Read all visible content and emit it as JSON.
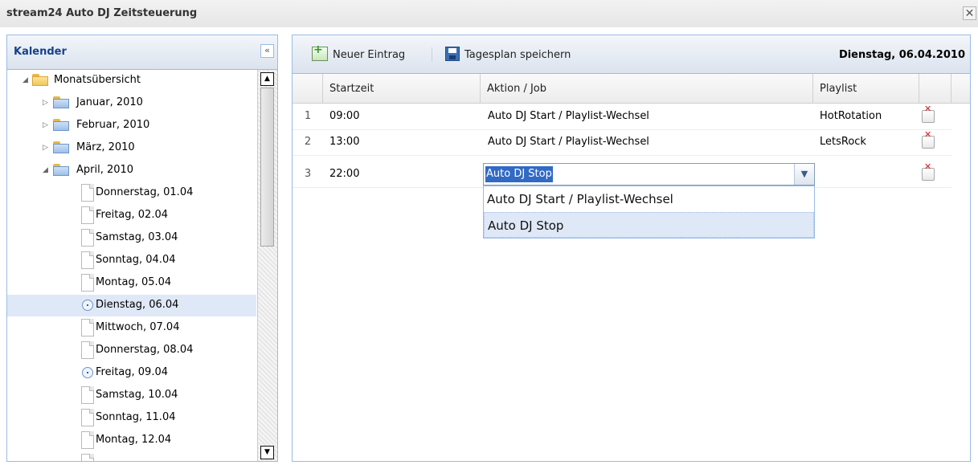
{
  "window": {
    "title": "stream24 Auto DJ Zeitsteuerung",
    "close_symbol": "✕"
  },
  "calendar": {
    "title": "Kalender",
    "collapse_symbol": "«",
    "tree": {
      "root": "Monatsübersicht",
      "months": [
        "Januar, 2010",
        "Februar, 2010",
        "März, 2010",
        "April, 2010"
      ],
      "days": [
        {
          "label": "Donnerstag, 01.04",
          "icon": "page-icon"
        },
        {
          "label": "Freitag, 02.04",
          "icon": "page-icon"
        },
        {
          "label": "Samstag, 03.04",
          "icon": "page-icon"
        },
        {
          "label": "Sonntag, 04.04",
          "icon": "page-icon"
        },
        {
          "label": "Montag, 05.04",
          "icon": "page-icon"
        },
        {
          "label": "Dienstag, 06.04",
          "icon": "clock-icon",
          "selected": true
        },
        {
          "label": "Mittwoch, 07.04",
          "icon": "page-icon"
        },
        {
          "label": "Donnerstag, 08.04",
          "icon": "page-icon"
        },
        {
          "label": "Freitag, 09.04",
          "icon": "clock-icon"
        },
        {
          "label": "Samstag, 10.04",
          "icon": "page-icon"
        },
        {
          "label": "Sonntag, 11.04",
          "icon": "page-icon"
        },
        {
          "label": "Montag, 12.04",
          "icon": "page-icon"
        }
      ]
    }
  },
  "toolbar": {
    "new_entry": "Neuer Eintrag",
    "save_plan": "Tagesplan speichern",
    "date": "Dienstag, 06.04.2010"
  },
  "grid": {
    "columns": [
      "Startzeit",
      "Aktion / Job",
      "Playlist"
    ],
    "rows": [
      {
        "num": "1",
        "start": "09:00",
        "action": "Auto DJ Start / Playlist-Wechsel",
        "playlist": "HotRotation"
      },
      {
        "num": "2",
        "start": "13:00",
        "action": "Auto DJ Start / Playlist-Wechsel",
        "playlist": "LetsRock"
      },
      {
        "num": "3",
        "start": "22:00",
        "action": "",
        "playlist": ""
      }
    ]
  },
  "editor": {
    "value": "Auto DJ Stop",
    "options": [
      "Auto DJ Start / Playlist-Wechsel",
      "Auto DJ Stop"
    ],
    "hover_index": 1
  },
  "colors": {
    "border": "#99bbe8",
    "selection": "#dfe8f6",
    "header_text": "#15428b",
    "delete_red": "#e01919"
  }
}
